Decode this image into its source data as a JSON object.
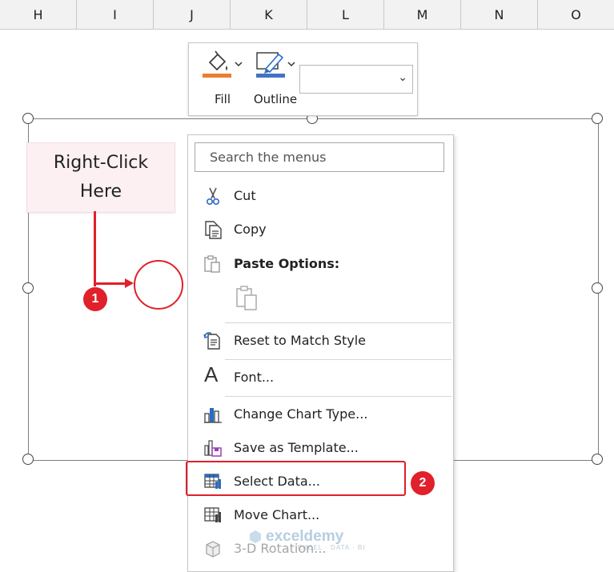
{
  "columns": [
    "H",
    "I",
    "J",
    "K",
    "L",
    "M",
    "N",
    "O"
  ],
  "mini_toolbar": {
    "fill_label": "Fill",
    "outline_label": "Outline",
    "fill_color": "#ed7d31",
    "outline_color": "#4472c4",
    "select_value": ""
  },
  "callout": {
    "text": "Right-Click\nHere",
    "step1": "1",
    "step2": "2"
  },
  "context_menu": {
    "search_placeholder": "Search the menus",
    "cut": "Cut",
    "copy": "Copy",
    "paste_options": "Paste Options:",
    "reset_style": "Reset to Match Style",
    "font": "Font...",
    "change_chart_type": "Change Chart Type...",
    "save_template": "Save as Template...",
    "select_data": "Select Data...",
    "move_chart": "Move Chart...",
    "rotation_3d": "3-D Rotation..."
  },
  "watermark": {
    "name": "exceldemy",
    "tagline": "EXCEL · DATA · BI"
  },
  "colors": {
    "annotation_red": "#e0202a",
    "callout_bg": "#fcf0f2"
  }
}
